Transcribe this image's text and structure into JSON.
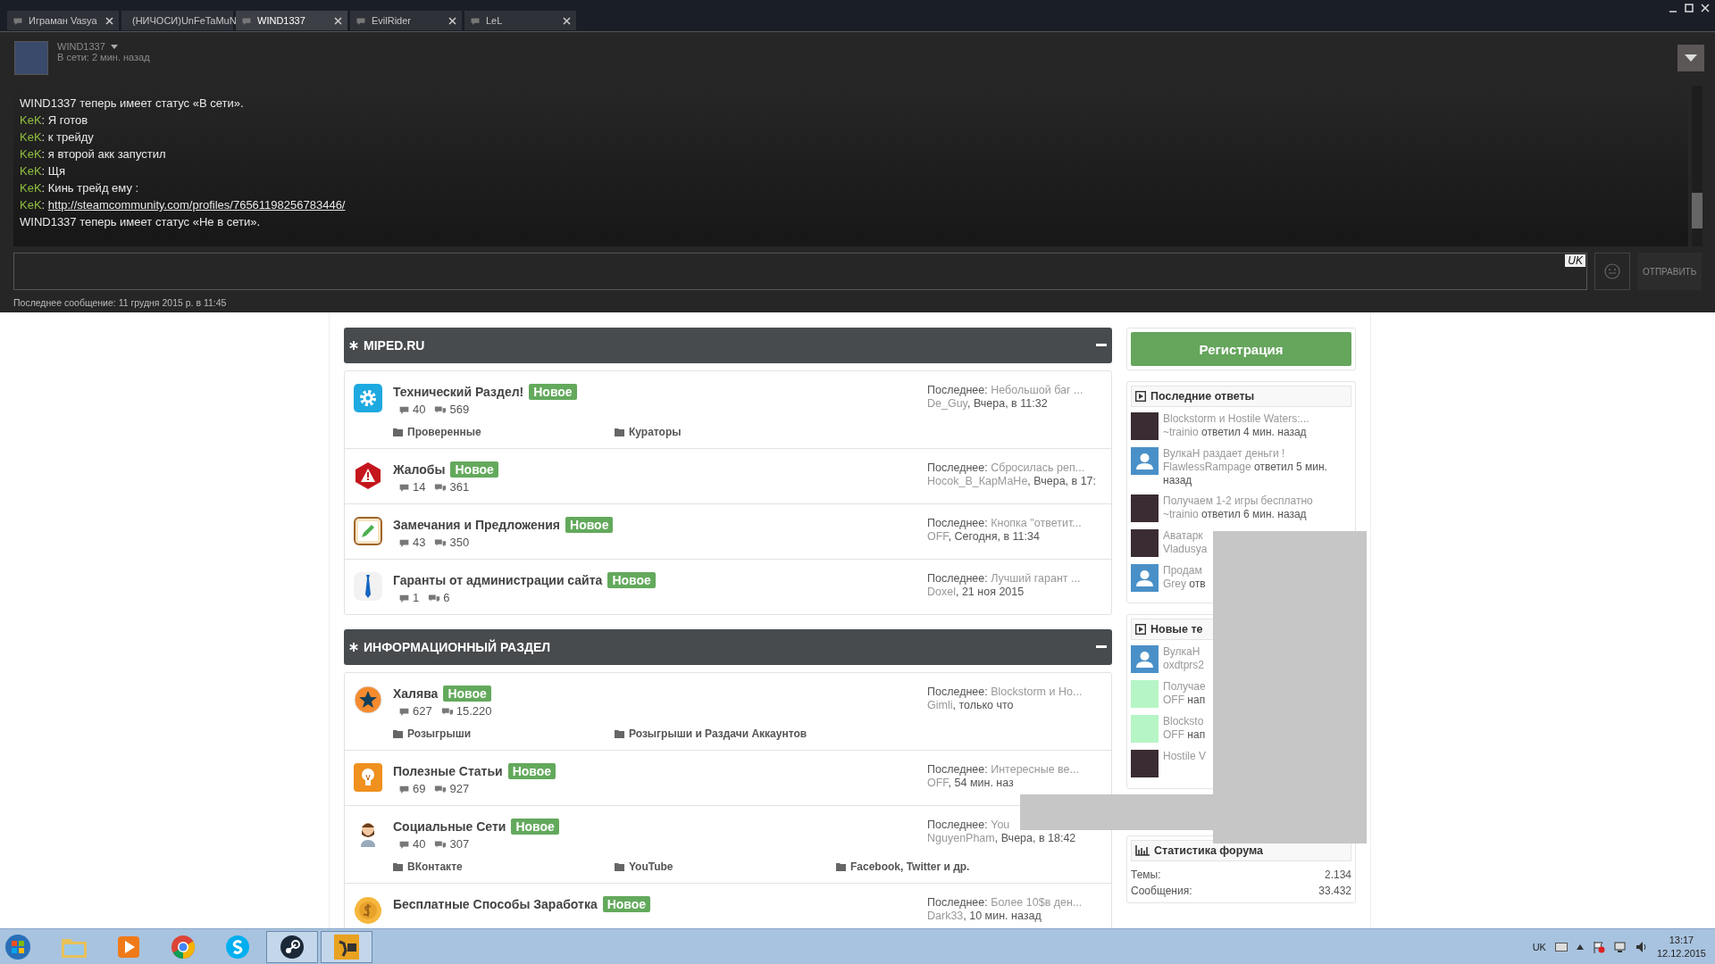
{
  "tabs": [
    {
      "label": "Играман Vasya",
      "selected": false
    },
    {
      "label": "(НИЧОСИ)UnFeTaMuN",
      "selected": false
    },
    {
      "label": "WIND1337",
      "selected": true
    },
    {
      "label": "EvilRider",
      "selected": false
    },
    {
      "label": "LeL",
      "selected": false
    }
  ],
  "chat": {
    "contact": "WIND1337",
    "status": "В сети: 2 мин. назад",
    "messages": [
      {
        "kind": "status",
        "text": "WIND1337 теперь имеет статус «В сети»."
      },
      {
        "kind": "message",
        "author": "KeK",
        "text": ": Я готов"
      },
      {
        "kind": "message",
        "author": "KeK",
        "text": ": к трейду"
      },
      {
        "kind": "message",
        "author": "KeK",
        "text": ": я второй акк запустил"
      },
      {
        "kind": "message",
        "author": "KeK",
        "text": ": Щя"
      },
      {
        "kind": "message",
        "author": "KeK",
        "text": ": Кинь трейд ему :"
      },
      {
        "kind": "link",
        "author": "KeK",
        "text": ": ",
        "link": "http://steamcommunity.com/profiles/76561198256783446/"
      },
      {
        "kind": "status",
        "text": "WIND1337 теперь имеет статус «Не в сети»."
      }
    ],
    "language": "UK",
    "send_button": "ОТПРАВИТЬ",
    "last_message": "Последнее сообщение: 11 грудня 2015 р. в 11:45"
  },
  "forum": {
    "categories": [
      {
        "title": "MIPED.RU",
        "forums": [
          {
            "kind": "gear",
            "title": "Технический Раздел!",
            "badge": "Новое",
            "threads": "40",
            "posts": "569",
            "subforums": [
              "Проверенные",
              "Кураторы"
            ],
            "last_label": "Последнее:",
            "last_title": "Небольшой баг ...",
            "last_user": "De_Guy",
            "last_time": ", Вчера, в 11:32"
          },
          {
            "kind": "warning",
            "title": "Жалобы",
            "badge": "Новое",
            "threads": "14",
            "posts": "361",
            "last_label": "Последнее:",
            "last_title": "Сбросилась реп...",
            "last_user": "Hocok_B_КарМаНе",
            "last_time": ", Вчера, в 17:"
          },
          {
            "kind": "pencil",
            "title": "Замечания и Предложения",
            "badge": "Новое",
            "threads": "43",
            "posts": "350",
            "last_label": "Последнее:",
            "last_title": "Кнопка \"ответит...",
            "last_user": "OFF",
            "last_time": ", Сегодня, в 11:34"
          },
          {
            "kind": "tie",
            "title": "Гаранты от администрации сайта",
            "badge": "Новое",
            "threads": "1",
            "posts": "6",
            "last_label": "Последнее:",
            "last_title": "Лучший гарант ...",
            "last_user": "Doxel",
            "last_time": ", 21 ноя 2015"
          }
        ]
      },
      {
        "title": "ИНФОРМАЦИОННЫЙ РАЗДЕЛ",
        "forums": [
          {
            "kind": "star",
            "title": "Халява",
            "badge": "Новое",
            "threads": "627",
            "posts": "15.220",
            "subforums": [
              "Розыгрыши",
              "Розыгрыши и Раздачи Аккаунтов"
            ],
            "last_label": "Последнее:",
            "last_title": "Blockstorm и Ho...",
            "last_user": "Gimli",
            "last_time": ", только что"
          },
          {
            "kind": "bulb",
            "title": "Полезные Статьи",
            "badge": "Новое",
            "threads": "69",
            "posts": "927",
            "last_label": "Последнее:",
            "last_title": "Интересные ве...",
            "last_user": "OFF",
            "last_time": ", 54 мин. наз"
          },
          {
            "kind": "person",
            "title": "Социальные Сети",
            "badge": "Новое",
            "threads": "40",
            "posts": "307",
            "subforums": [
              "ВКонтакте",
              "YouTube",
              "Facebook, Twitter и др."
            ],
            "last_label": "Последнее:",
            "last_title": "You",
            "last_user": "NguyenPham",
            "last_time": ", Вчера, в 18:42"
          },
          {
            "kind": "coin",
            "title": "Бесплатные Способы Заработка",
            "badge": "Новое",
            "last_label": "Последнее:",
            "last_title": "Более 10$в ден...",
            "last_user": "Dark33",
            "last_time": ", 10 мин. назад"
          }
        ]
      }
    ]
  },
  "sidebar": {
    "register_button": "Регистрация",
    "panels": [
      {
        "title": "Последние ответы",
        "items": [
          {
            "kind": "photo",
            "title": "Blockstorm и Hostile Waters:...",
            "user": "~trainio",
            "action": "ответил 4 мин. назад"
          },
          {
            "kind": "default",
            "title": "ВулкаН раздает деньги !",
            "user": "FlawlessRampage",
            "action": "ответил 5 мин. назад"
          },
          {
            "kind": "photo",
            "title": "Получаем 1-2 игры бесплатно",
            "user": "~trainio",
            "action": "ответил 6 мин. назад"
          },
          {
            "kind": "photo",
            "title": "Аватарк",
            "user": "Vladusya"
          },
          {
            "kind": "default",
            "title": "Продам",
            "user": "Grey",
            "action": "отв"
          }
        ]
      },
      {
        "title": "Новые те",
        "items": [
          {
            "kind": "default",
            "title": "ВулкаН",
            "user": "oxdtprs2"
          },
          {
            "kind": "off",
            "title": "Получае",
            "user": "OFF",
            "action": "нап"
          },
          {
            "kind": "off",
            "title": "Blocksto",
            "user": "OFF",
            "action": "нап"
          },
          {
            "kind": "photo",
            "title": "Hostile V"
          }
        ]
      }
    ],
    "stats": {
      "title": "Статистика форума",
      "rows": [
        {
          "label": "Темы:",
          "value": "2.134"
        },
        {
          "label": "Сообщения:",
          "value": "33.432"
        }
      ]
    }
  },
  "taskbar": {
    "apps": [
      {
        "kind": "explorer",
        "running": false
      },
      {
        "kind": "media",
        "running": false
      },
      {
        "kind": "chrome",
        "running": false
      },
      {
        "kind": "skype",
        "running": false
      },
      {
        "kind": "steam",
        "running": true
      },
      {
        "kind": "game",
        "running": true
      }
    ],
    "tray": {
      "language": "UK",
      "time": "13:17",
      "date": "12.12.2015"
    }
  }
}
